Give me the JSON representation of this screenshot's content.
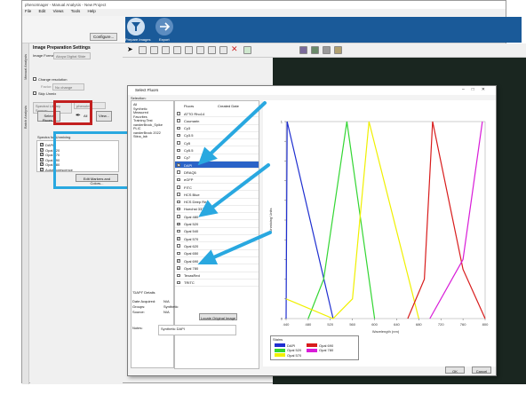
{
  "window": {
    "title": "phenoImager - Manual Analysis - New Project"
  },
  "menu": [
    "File",
    "Edit",
    "Views",
    "Tools",
    "Help"
  ],
  "ribbon": {
    "configure_label": "Configure...",
    "prepare_label": "Prepare Images",
    "export_label": "Export"
  },
  "vtabs": [
    "Manual Analysis",
    "Batch Analysis"
  ],
  "left_panel": {
    "title": "Image Preparation Settings",
    "image_format_label": "Image Format:",
    "image_format_value": "Akoya Digital Slide",
    "change_resolution_label": "Change resolution",
    "factor_label": "Factor:",
    "factor_value": "No change",
    "skip_unmix_label": "Skip Unmix",
    "spectral_source_label": "Spectral Library Source:",
    "spectral_source_value": "phenoIm",
    "select_fluors_label": "Select Fluors...",
    "view_label": "View...",
    "spectra_title": "Spectra for Unmixing",
    "spectra": [
      "DAPI",
      "Opal 520",
      "Opal 570",
      "Opal 690",
      "Opal 780",
      "Autofluorescence"
    ],
    "edit_markers_label": "Edit Markers and Colors..."
  },
  "dialog": {
    "title": "Select Fluors",
    "selection_label": "Selection:",
    "tree": [
      "All",
      "Synthetic",
      "Measured",
      "Favorites",
      "Training Test",
      "vanderBrock_Spike",
      "PLIC",
      "vanderBrock 2022",
      "Stina_lab"
    ],
    "fluors_header": "Fluors",
    "created_header": "Created Date",
    "fluors": [
      {
        "name": "ATTO Rho14",
        "checked": false
      },
      {
        "name": "Coumarin",
        "checked": false
      },
      {
        "name": "Cy3",
        "checked": false
      },
      {
        "name": "Cy3.5",
        "checked": false
      },
      {
        "name": "Cy5",
        "checked": false
      },
      {
        "name": "Cy5.5",
        "checked": false
      },
      {
        "name": "Cy7",
        "checked": false
      },
      {
        "name": "DAPI",
        "checked": true
      },
      {
        "name": "DRAQ5",
        "checked": false
      },
      {
        "name": "eGFP",
        "checked": false
      },
      {
        "name": "FITC",
        "checked": false
      },
      {
        "name": "HCS Blue",
        "checked": false
      },
      {
        "name": "HCS Deep Red",
        "checked": false
      },
      {
        "name": "Hoechst 33342",
        "checked": false
      },
      {
        "name": "Opal 480",
        "checked": false
      },
      {
        "name": "Opal 520",
        "checked": true
      },
      {
        "name": "Opal 540",
        "checked": false
      },
      {
        "name": "Opal 570",
        "checked": true
      },
      {
        "name": "Opal 620",
        "checked": false
      },
      {
        "name": "Opal 650",
        "checked": false
      },
      {
        "name": "Opal 690",
        "checked": true
      },
      {
        "name": "Opal 780",
        "checked": true
      },
      {
        "name": "TexasRed",
        "checked": false
      },
      {
        "name": "TRITC",
        "checked": false
      }
    ],
    "selected_index": 7,
    "details_title": "\"DAPI\" Details",
    "date_acquired_label": "Date Acquired:",
    "date_acquired_value": "N/A",
    "groups_label": "Groups:",
    "groups_value": "Synthetic",
    "source_label": "Source:",
    "source_value": "N/A",
    "locate_label": "Locate Original Image",
    "notes_label": "Notes:",
    "notes_value": "Synthetic DAPI",
    "stains_title": "Stains",
    "ok_label": "OK",
    "cancel_label": "Cancel"
  },
  "chart_data": {
    "type": "line",
    "xlabel": "Wavelength (nm)",
    "ylabel": "Unmixing Units",
    "xlim": [
      440,
      800
    ],
    "ylim": [
      0,
      1
    ],
    "x_ticks": [
      440,
      480,
      520,
      560,
      600,
      640,
      680,
      720,
      760,
      800
    ],
    "y_ticks": [
      0,
      0.1,
      0.2,
      0.3,
      0.4,
      0.5,
      0.6,
      0.7,
      0.8,
      0.9,
      1
    ],
    "series": [
      {
        "name": "DAPI",
        "color": "#1f2fd0",
        "points": [
          [
            440,
            0
          ],
          [
            442,
            1
          ],
          [
            525,
            0
          ]
        ]
      },
      {
        "name": "Opal 520",
        "color": "#33d633",
        "points": [
          [
            480,
            0
          ],
          [
            508,
            0.2
          ],
          [
            550,
            1
          ],
          [
            600,
            0
          ]
        ]
      },
      {
        "name": "Opal 570",
        "color": "#f0f000",
        "points": [
          [
            440,
            0.1
          ],
          [
            525,
            0
          ],
          [
            560,
            0.1
          ],
          [
            590,
            1
          ],
          [
            680,
            0
          ]
        ]
      },
      {
        "name": "Opal 690",
        "color": "#d81c1c",
        "points": [
          [
            660,
            0
          ],
          [
            690,
            0.2
          ],
          [
            705,
            1
          ],
          [
            760,
            0.25
          ],
          [
            800,
            0
          ]
        ]
      },
      {
        "name": "Opal 780",
        "color": "#d81cd8",
        "points": [
          [
            700,
            0
          ],
          [
            760,
            0.3
          ],
          [
            795,
            1
          ]
        ]
      }
    ],
    "legend_position": "bottom-left"
  }
}
